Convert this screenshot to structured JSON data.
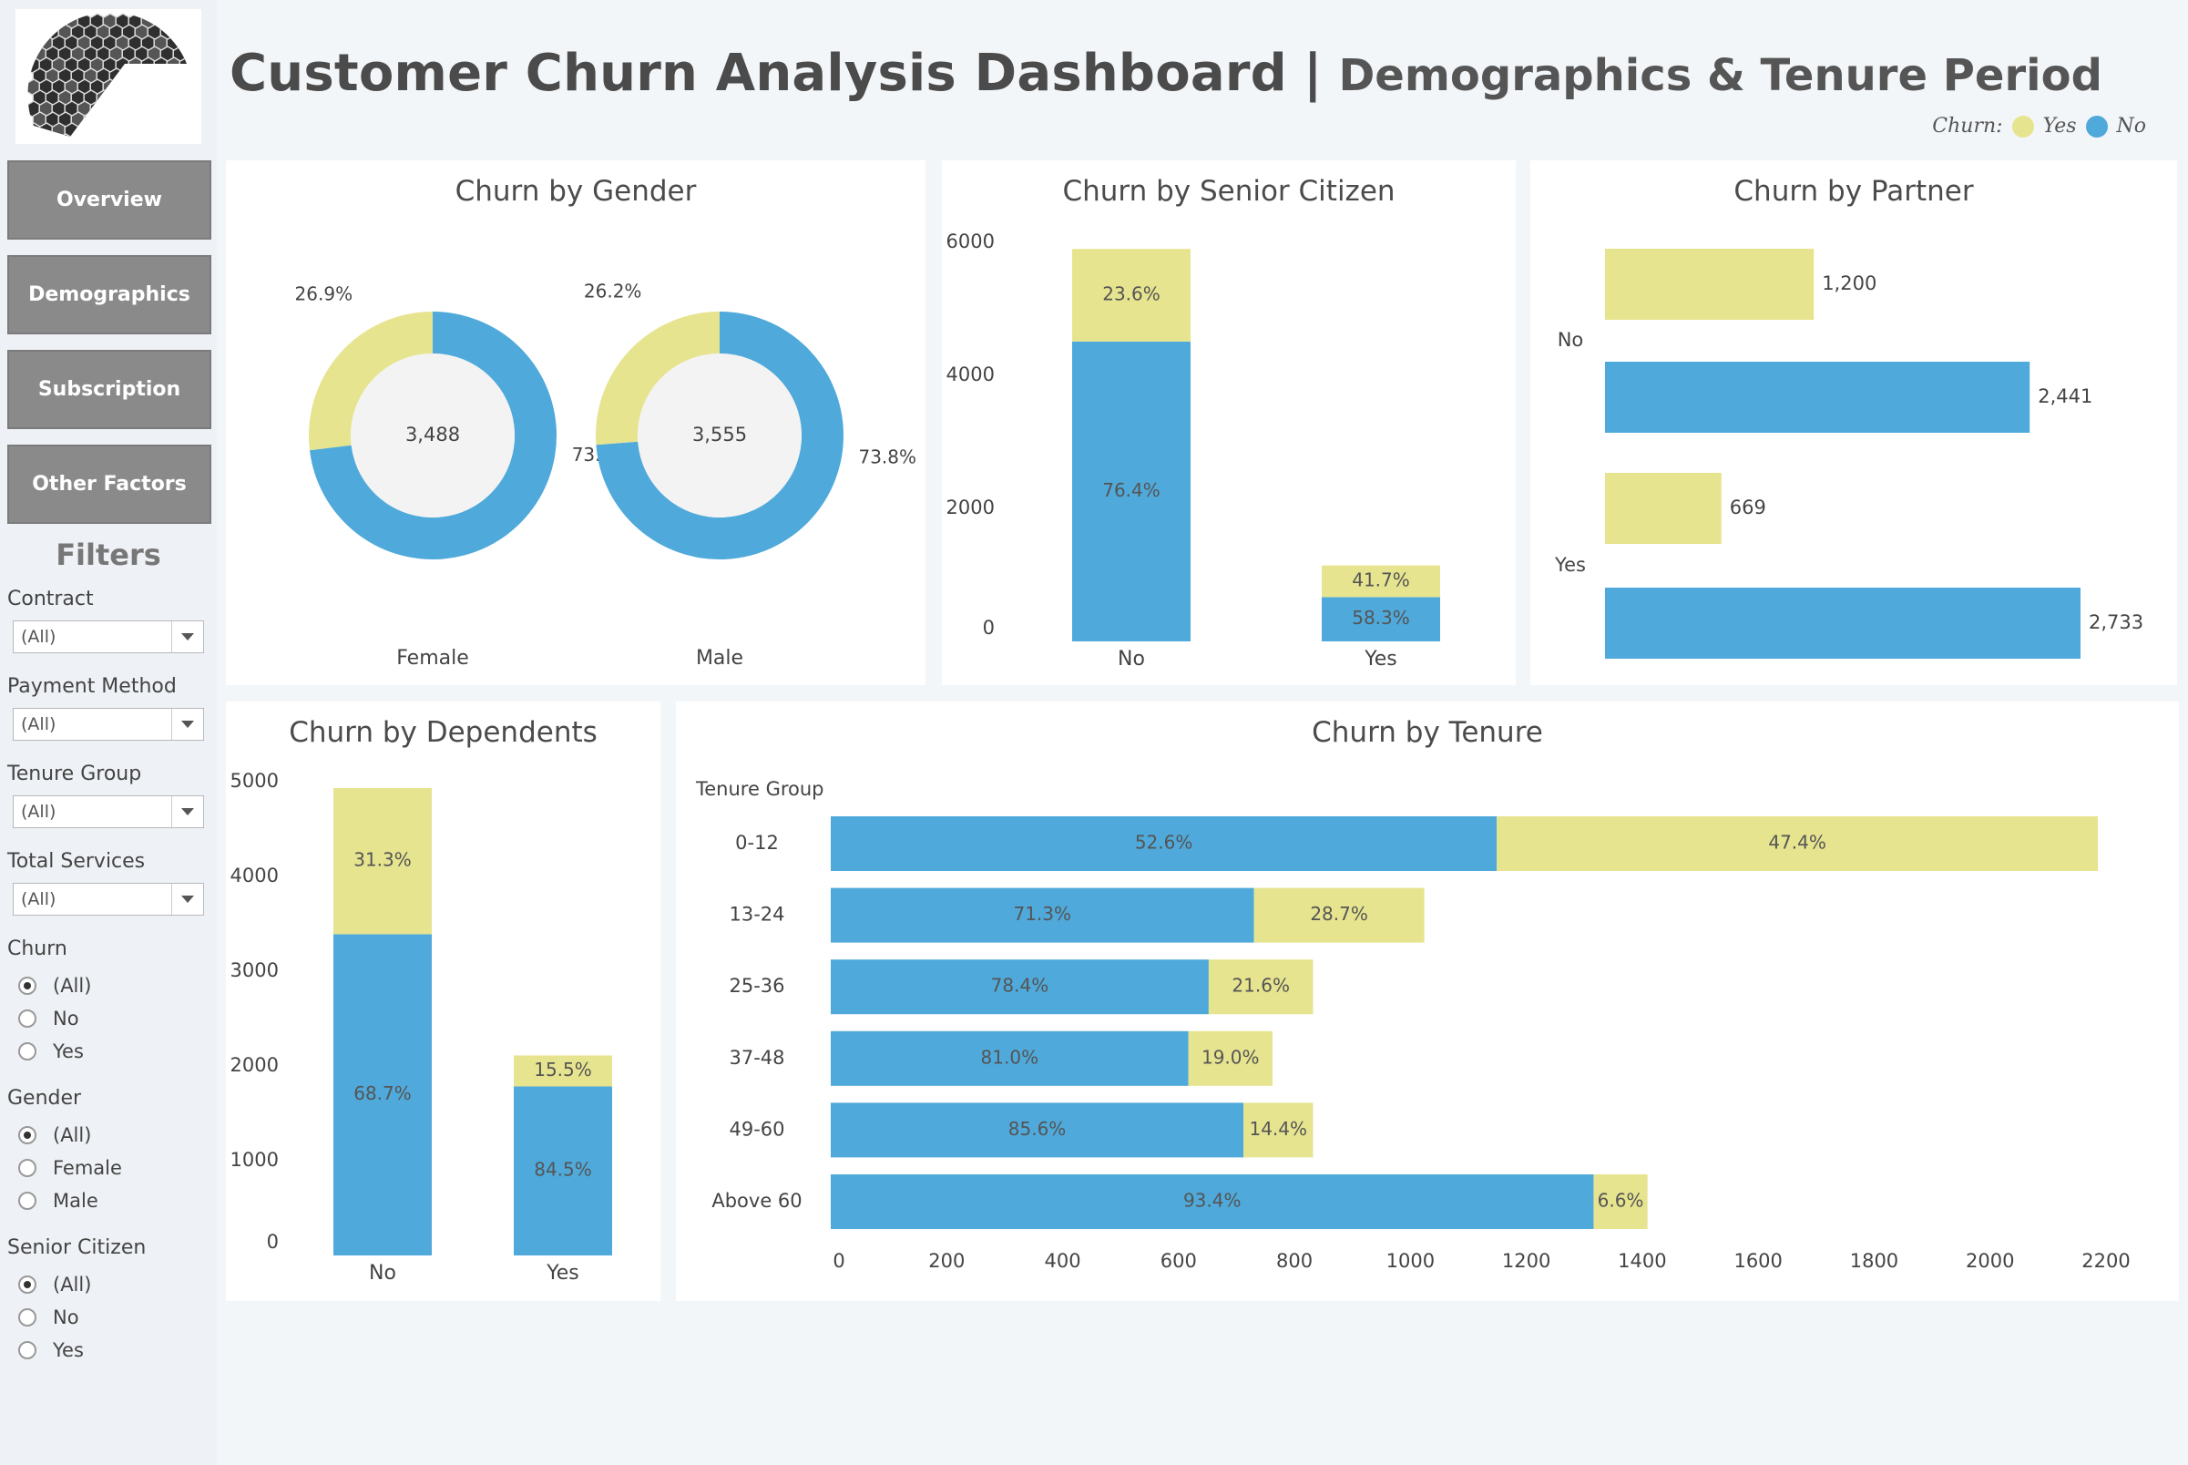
{
  "header": {
    "title": "Customer Churn Analysis Dashboard",
    "separator": "|",
    "subtitle": "Demographics & Tenure Period"
  },
  "legend": {
    "label": "Churn:",
    "yes": "Yes",
    "no": "No"
  },
  "colors": {
    "yes": "#e6e48f",
    "no": "#4fa9da",
    "label_dark": "#4b4b4b"
  },
  "nav": {
    "overview": "Overview",
    "demographics": "Demographics",
    "subscription": "Subscription",
    "other_factors": "Other Factors"
  },
  "filters": {
    "title": "Filters",
    "contract": {
      "label": "Contract",
      "value": "(All)"
    },
    "payment_method": {
      "label": "Payment Method",
      "value": "(All)"
    },
    "tenure_group": {
      "label": "Tenure Group",
      "value": "(All)"
    },
    "total_services": {
      "label": "Total Services",
      "value": "(All)"
    },
    "churn": {
      "label": "Churn",
      "options": [
        "(All)",
        "No",
        "Yes"
      ]
    },
    "gender": {
      "label": "Gender",
      "options": [
        "(All)",
        "Female",
        "Male"
      ]
    },
    "senior_citizen": {
      "label": "Senior Citizen",
      "options": [
        "(All)",
        "No",
        "Yes"
      ]
    }
  },
  "chart_data": [
    {
      "type": "pie",
      "title": "Churn by Gender",
      "donuts": [
        {
          "label": "Female",
          "total": "3,488",
          "yes_pct": 26.9,
          "no_pct": 73.1,
          "yes_label": "26.9%",
          "no_label": "73.1%"
        },
        {
          "label": "Male",
          "total": "3,555",
          "yes_pct": 26.2,
          "no_pct": 73.8,
          "yes_label": "26.2%",
          "no_label": "73.8%"
        }
      ]
    },
    {
      "type": "bar",
      "title": "Churn by Senior Citizen",
      "categories": [
        "No",
        "Yes"
      ],
      "series": [
        {
          "name": "No",
          "values": [
            4508,
            666
          ],
          "labels": [
            "76.4%",
            "58.3%"
          ]
        },
        {
          "name": "Yes",
          "values": [
            1393,
            476
          ],
          "labels": [
            "23.6%",
            "41.7%"
          ]
        }
      ],
      "yticks": [
        "0",
        "2000",
        "4000",
        "6000"
      ],
      "ylim": [
        0,
        6000
      ]
    },
    {
      "type": "bar",
      "title": "Churn by Partner",
      "categories": [
        "No",
        "Yes"
      ],
      "series": [
        {
          "name": "Yes",
          "values": [
            1200,
            669
          ],
          "labels": [
            "1,200",
            "669"
          ]
        },
        {
          "name": "No",
          "values": [
            2441,
            2733
          ],
          "labels": [
            "2,441",
            "2,733"
          ]
        }
      ],
      "xlim": [
        0,
        2733
      ]
    },
    {
      "type": "bar",
      "title": "Churn by Dependents",
      "categories": [
        "No",
        "Yes"
      ],
      "series": [
        {
          "name": "No",
          "values": [
            3390,
            1784
          ],
          "labels": [
            "68.7%",
            "84.5%"
          ]
        },
        {
          "name": "Yes",
          "values": [
            1543,
            327
          ],
          "labels": [
            "31.3%",
            "15.5%"
          ]
        }
      ],
      "yticks": [
        "0",
        "1000",
        "2000",
        "3000",
        "4000",
        "5000"
      ],
      "ylim": [
        0,
        5000
      ]
    },
    {
      "type": "bar",
      "title": "Churn by Tenure",
      "ylabel": "Tenure Group",
      "categories": [
        "0-12",
        "13-24",
        "25-36",
        "37-48",
        "49-60",
        "Above 60"
      ],
      "series": [
        {
          "name": "No",
          "values": [
            1149,
            730,
            652,
            617,
            712,
            1316
          ],
          "labels": [
            "52.6%",
            "71.3%",
            "78.4%",
            "81.0%",
            "85.6%",
            "93.4%"
          ]
        },
        {
          "name": "Yes",
          "values": [
            1037,
            294,
            180,
            145,
            120,
            93
          ],
          "labels": [
            "47.4%",
            "28.7%",
            "21.6%",
            "19.0%",
            "14.4%",
            "6.6%"
          ]
        }
      ],
      "xticks": [
        "0",
        "200",
        "400",
        "600",
        "800",
        "1000",
        "1200",
        "1400",
        "1600",
        "1800",
        "2000",
        "2200"
      ],
      "xlim": [
        0,
        2200
      ]
    }
  ]
}
